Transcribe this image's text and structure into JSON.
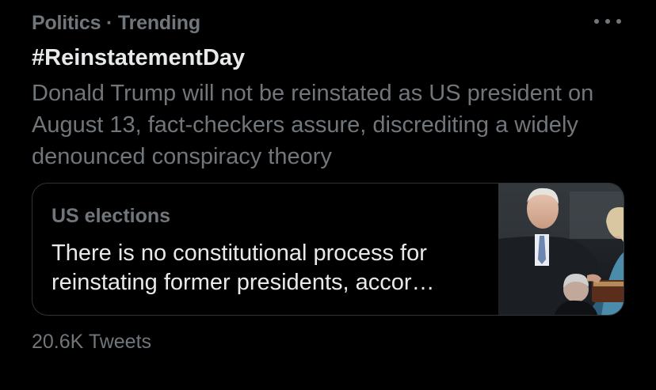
{
  "trend": {
    "context": "Politics · Trending",
    "title": "#ReinstatementDay",
    "description": "Donald Trump will not be reinstated as US president on August 13, fact-checkers assure, discrediting a widely denounced conspiracy theory",
    "more_icon": "more-horizontal-icon",
    "card": {
      "topic": "US elections",
      "headline": "There is no constitutional process for reinstating former presidents, accor…",
      "media": "inauguration-photo"
    },
    "tweet_count": "20.6K Tweets"
  },
  "colors": {
    "background": "#000000",
    "primary_text": "#e7e9ea",
    "secondary_text": "#71767b",
    "border": "#2f3336"
  }
}
